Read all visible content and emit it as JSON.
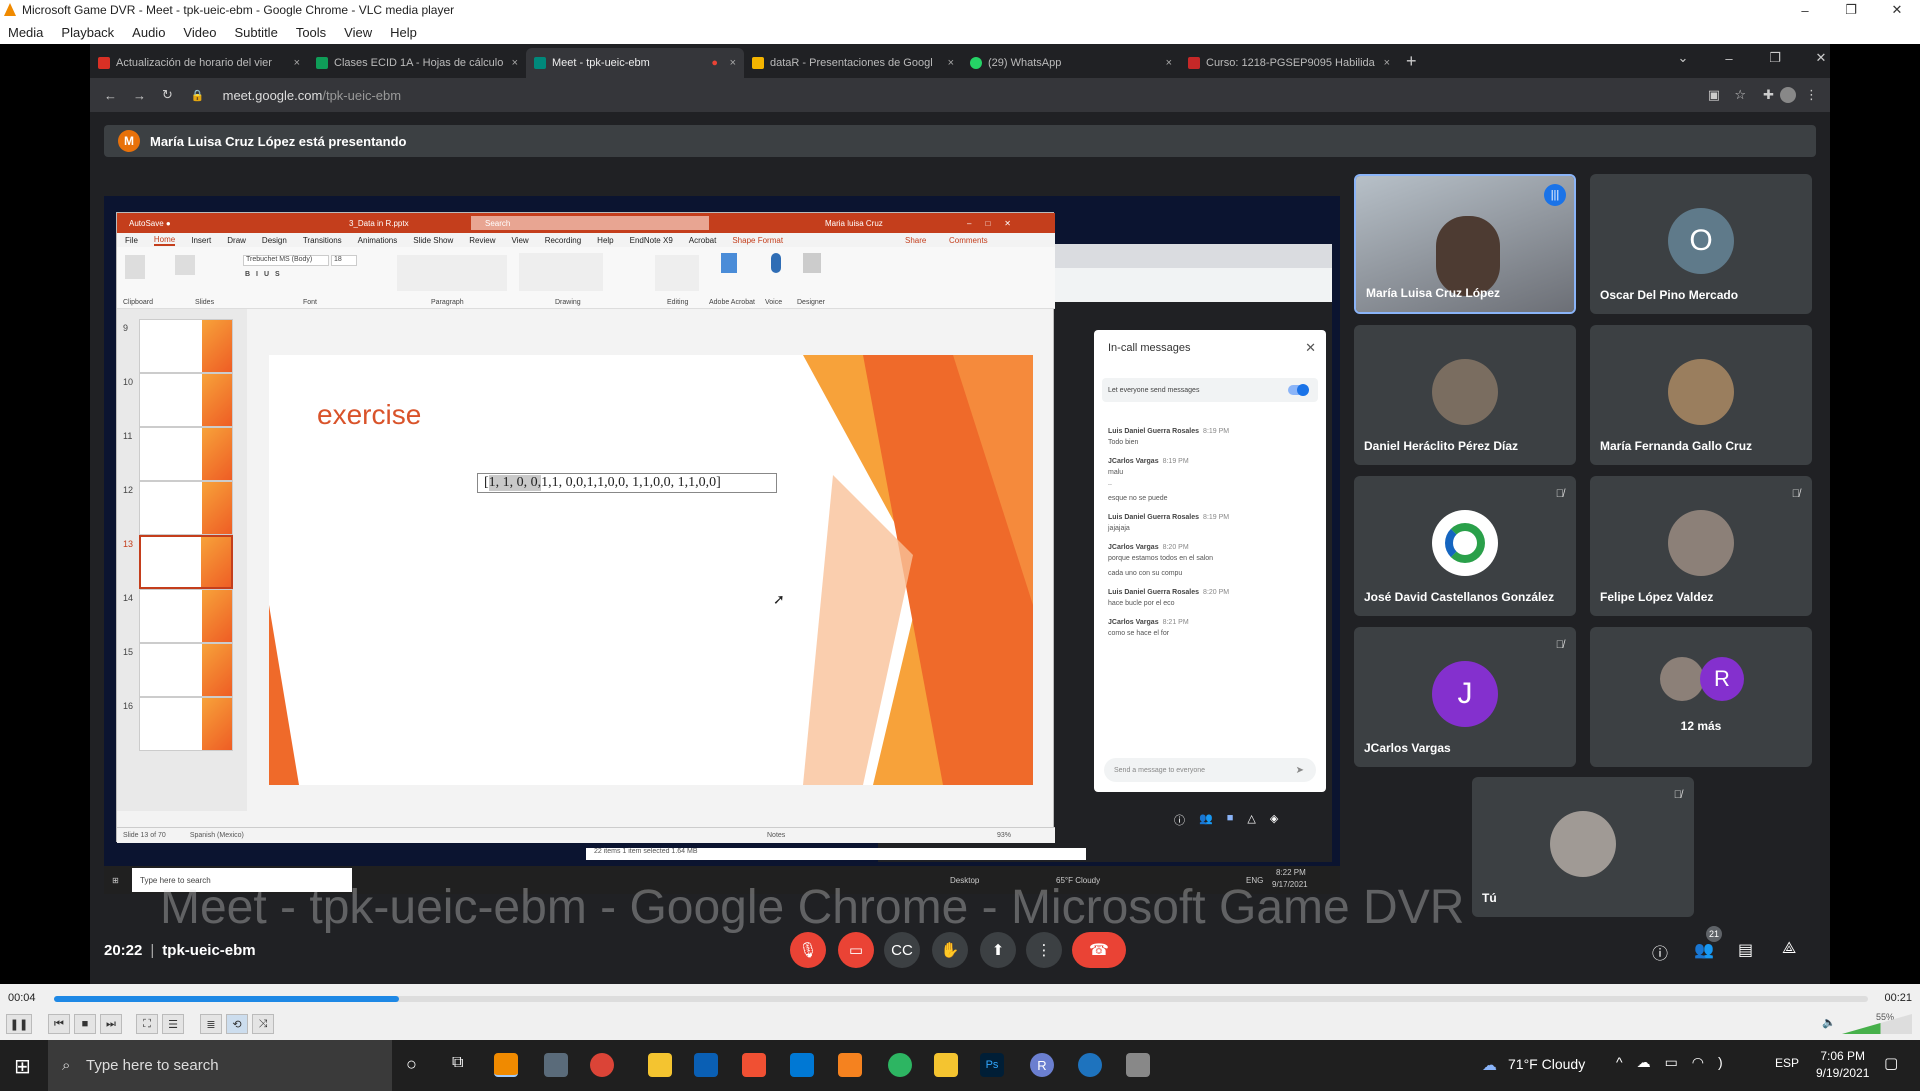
{
  "vlc": {
    "window_title": "Microsoft Game DVR - Meet - tpk-ueic-ebm - Google Chrome - VLC media player",
    "menu": [
      "Media",
      "Playback",
      "Audio",
      "Video",
      "Subtitle",
      "Tools",
      "View",
      "Help"
    ],
    "time_elapsed": "00:04",
    "time_total": "00:21",
    "progress": 0.19,
    "volume": "55%"
  },
  "chrome": {
    "tabs": [
      {
        "label": "Actualización de horario del vier",
        "color": "#d93025"
      },
      {
        "label": "Clases ECID 1A - Hojas de cálculo",
        "color": "#0f9d58"
      },
      {
        "label": "Meet - tpk-ueic-ebm",
        "color": "#00897b",
        "active": true
      },
      {
        "label": "dataR - Presentaciones de Googl",
        "color": "#f4b400"
      },
      {
        "label": "(29) WhatsApp",
        "color": "#25d366"
      },
      {
        "label": "Curso: 1218-PGSEP9095 Habilida",
        "color": "#c62828"
      }
    ],
    "url_host": "meet.google.com",
    "url_path": "/tpk-ueic-ebm"
  },
  "meet": {
    "presenting_initial": "M",
    "presenting_text": "María Luisa Cruz López está presentando",
    "meeting_time": "20:22",
    "meeting_code": "tpk-ueic-ebm",
    "participant_count": "21",
    "participants": [
      {
        "name": "María Luisa Cruz López",
        "avatar": "photo",
        "bg": "#8a8f97"
      },
      {
        "name": "Oscar Del Pino Mercado",
        "avatar": "O",
        "bg": "#5f7a8a"
      },
      {
        "name": "Daniel Heráclito Pérez Díaz",
        "avatar": "photo",
        "bg": "#7a6d60"
      },
      {
        "name": "María Fernanda Gallo Cruz",
        "avatar": "photo",
        "bg": "#9a7e5e"
      },
      {
        "name": "José David Castellanos González",
        "avatar": "logo",
        "bg": "#ffffff"
      },
      {
        "name": "Felipe López Valdez",
        "avatar": "photo",
        "bg": "#8c8078"
      },
      {
        "name": "JCarlos Vargas",
        "avatar": "J",
        "bg": "#8430ce"
      },
      {
        "name": "12 más",
        "avatar": "R",
        "bg": "#8430ce"
      },
      {
        "name": "Tú",
        "avatar": "photo",
        "bg": "#a09a95"
      }
    ],
    "overlay_title": "Meet - tpk-ueic-ebm - Google Chrome - Microsoft Game DVR"
  },
  "ppt": {
    "title": "3_Data in R.pptx",
    "search": "Search",
    "user": "Maria luisa Cruz",
    "tabs": [
      "File",
      "Home",
      "Insert",
      "Draw",
      "Design",
      "Transitions",
      "Animations",
      "Slide Show",
      "Review",
      "View",
      "Recording",
      "Help",
      "EndNote X9",
      "Acrobat",
      "Shape Format"
    ],
    "share": "Share",
    "comments": "Comments",
    "font": "Trebuchet MS (Body)",
    "font_size": "18",
    "groups": [
      "Clipboard",
      "Slides",
      "Font",
      "Paragraph",
      "Drawing",
      "Editing",
      "Adobe Acrobat",
      "Voice",
      "Designer"
    ],
    "slide_numbers": [
      "9",
      "10",
      "11",
      "12",
      "13",
      "14",
      "15",
      "16"
    ],
    "slide_heading": "exercise",
    "slide_text_highlight": "1, 1, 0, 0,",
    "slide_text_prefix": "[",
    "slide_text_rest": " 1,1, 0,0,1,1,0,0, 1,1,0,0, 1,1,0,0]",
    "status_slide": "Slide 13 of 70",
    "status_lang": "Spanish (Mexico)",
    "status_notes": "Notes",
    "zoom": "93%"
  },
  "chat": {
    "title": "In-call messages",
    "toggle_label": "Let everyone send messages",
    "messages": [
      {
        "from": "Luis Daniel Guerra Rosales",
        "time": "8:19 PM",
        "lines": [
          "Todo bien"
        ]
      },
      {
        "from": "JCarlos Vargas",
        "time": "8:19 PM",
        "lines": [
          "malu",
          "..",
          "esque no se puede"
        ]
      },
      {
        "from": "Luis Daniel Guerra Rosales",
        "time": "8:19 PM",
        "lines": [
          "jajajaja"
        ]
      },
      {
        "from": "JCarlos Vargas",
        "time": "8:20 PM",
        "lines": [
          "porque estamos todos en el salon",
          "cada uno con su compu"
        ]
      },
      {
        "from": "Luis Daniel Guerra Rosales",
        "time": "8:20 PM",
        "lines": [
          "hace bucle por el eco"
        ]
      },
      {
        "from": "JCarlos Vargas",
        "time": "8:21 PM",
        "lines": [
          "como se hace el for"
        ]
      }
    ],
    "input_placeholder": "Send a message to everyone"
  },
  "inner_taskbar": {
    "search": "Type here to search",
    "weather": "65°F Cloudy",
    "lang": "ENG",
    "time": "8:22 PM",
    "date": "9/17/2021",
    "desktop": "Desktop",
    "explorer_status": "22 items     1 item selected  1.64 MB"
  },
  "taskbar": {
    "search": "Type here to search",
    "weather": "71°F  Cloudy",
    "lang": "ESP",
    "time": "7:06 PM",
    "date": "9/19/2021"
  }
}
